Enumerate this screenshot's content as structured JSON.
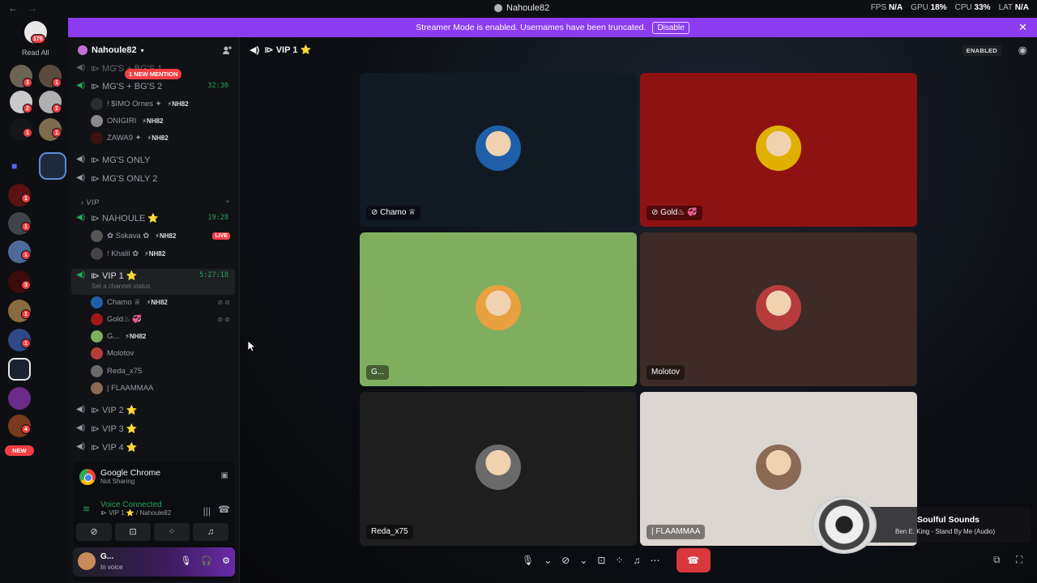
{
  "titlebar": {
    "title": "Nahoule82",
    "stats": [
      {
        "label": "FPS",
        "value": "N/A"
      },
      {
        "label": "GPU",
        "value": "18%"
      },
      {
        "label": "CPU",
        "value": "33%"
      },
      {
        "label": "LAT",
        "value": "N/A"
      }
    ]
  },
  "banner": {
    "text": "Streamer Mode is enabled. Usernames have been truncated.",
    "disable_label": "Disable"
  },
  "rail": {
    "read_all_badge": "175",
    "read_all_label": "Read All",
    "new_label": "NEW",
    "badges": [
      "3",
      "1",
      "2",
      "1",
      "1",
      "1",
      "1",
      "1",
      "1",
      "1",
      "3",
      "1",
      "1",
      "1",
      "4"
    ]
  },
  "sidebar": {
    "server_name": "Nahoule82",
    "mention_pill": "1 NEW MENTION",
    "channels": [
      {
        "name": "⧐ MG'S + BG'S 2",
        "time": "32:30"
      },
      {
        "name": "⧐ MG'S ONLY"
      },
      {
        "name": "⧐ MG'S ONLY 2"
      },
      {
        "name": "⧐ NAHOULE ⭐",
        "time": "19:28"
      },
      {
        "name": "⧐ VIP 1 ⭐",
        "time": "5:27:18"
      },
      {
        "name": "⧐ VIP 2 ⭐"
      },
      {
        "name": "⧐ VIP 3 ⭐"
      },
      {
        "name": "⧐ VIP 4 ⭐"
      }
    ],
    "top_channel": "⧐ MG'S + BG'S 1",
    "category": "VIP",
    "vip1_status": "Set a channel status",
    "mg_users": [
      "! $IMO Ornes ✦",
      "ONIGIRI",
      "ZAWA9 ✦"
    ],
    "nahoule_users": [
      "✿ Sskava ✿",
      "! Khalil ✿"
    ],
    "vip1_users": [
      "Chamo ♕",
      "Gold♨ 💞",
      "G...",
      "Molotov",
      "Reda_x75",
      "| FLAAMMAA"
    ],
    "nh_tag": "⚡NH82",
    "live_label": "LIVE"
  },
  "activity": {
    "app": "Google Chrome",
    "app_sub": "Not Sharing",
    "vc_label": "Voice Connected",
    "vc_sub": "⧐ VIP 1 ⭐ / Nahoule82"
  },
  "userpanel": {
    "name": "G...",
    "status": "In voice"
  },
  "main": {
    "channel_title": "⧐ VIP 1 ⭐",
    "enabled_label": "ENABLED",
    "tiles": [
      {
        "name": "Chamo ♕",
        "bg": "#111923",
        "ring": "#1f5fa8",
        "muted": true
      },
      {
        "name": "Gold♨ 💞",
        "bg": "#8e1212",
        "ring": "#e0b000",
        "muted": true
      },
      {
        "name": "G...",
        "bg": "#7fae5e",
        "ring": "#e8a040",
        "muted": false
      },
      {
        "name": "Molotov",
        "bg": "#3e2a26",
        "ring": "#b63c3c",
        "muted": false
      },
      {
        "name": "Reda_x75",
        "bg": "#1e1e1f",
        "ring": "#6a6a6a",
        "muted": false
      },
      {
        "name": "| FLAAMMAA",
        "bg": "#dcd6d1",
        "ring": "#8b6a55",
        "muted": false
      }
    ]
  },
  "music": {
    "title": "Soulful Sounds",
    "track": "Ben E. King - Stand By Me (Audio)"
  },
  "colors": {
    "brand_purple": "#8b3cf0",
    "voice_green": "#23a559",
    "danger_red": "#da373c"
  }
}
